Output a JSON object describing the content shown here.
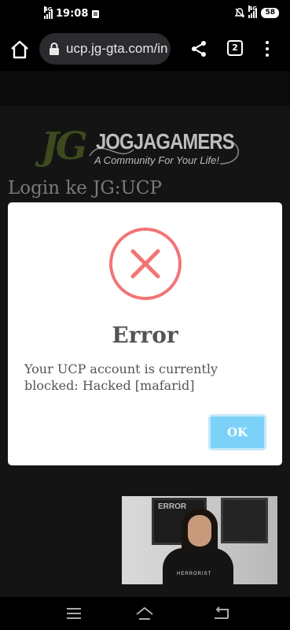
{
  "status_bar": {
    "time": "19:08",
    "network_left": "4G",
    "network_right": "4G",
    "battery": "58"
  },
  "browser": {
    "url": "ucp.jg-gta.com/in",
    "tab_count": "2"
  },
  "page": {
    "logo_initials": "JG",
    "logo_name": "JOGJAGAMERS",
    "logo_tagline": "A Community For Your Life!",
    "login_title": "Login ke JG:UCP"
  },
  "modal": {
    "title": "Error",
    "message": "Your UCP account is currently blocked: Hacked [mafarid]",
    "ok_label": "OK"
  },
  "video": {
    "poster_text": "ERROR",
    "shirt_text": "HERRORIST"
  },
  "colors": {
    "error_red": "#f27474",
    "ok_button": "#7cd1f9",
    "modal_text": "#545454"
  }
}
